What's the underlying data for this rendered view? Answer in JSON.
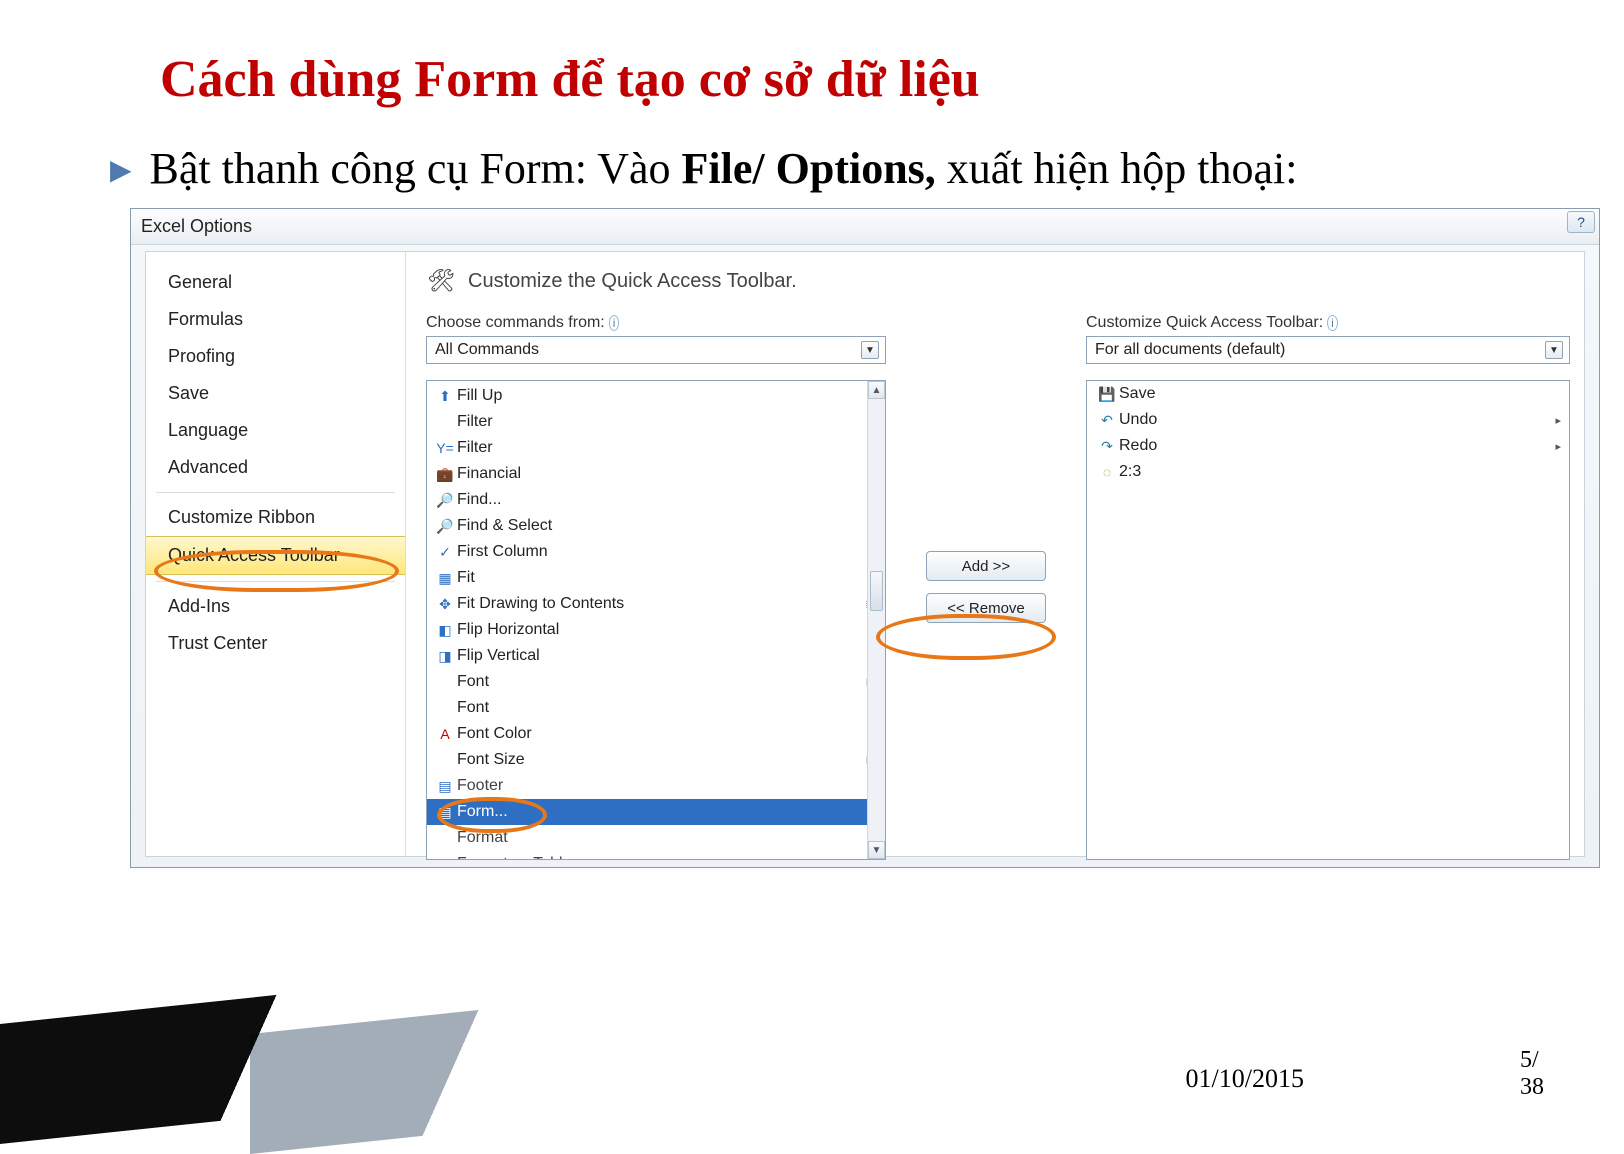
{
  "document": {
    "title": "Cách dùng Form để tạo cơ sở dữ liệu",
    "bullet_pre": "Bật thanh công cụ Form: Vào ",
    "bullet_bold": "File/ Options,",
    "bullet_post": " xuất hiện hộp thoại:",
    "footer_date": "01/10/2015",
    "footer_page_top": "5/",
    "footer_page_bot": "38"
  },
  "dialog": {
    "title": "Excel Options",
    "help": "?",
    "sidebar": {
      "items": [
        {
          "label": "General"
        },
        {
          "label": "Formulas"
        },
        {
          "label": "Proofing"
        },
        {
          "label": "Save"
        },
        {
          "label": "Language"
        },
        {
          "label": "Advanced"
        },
        {
          "label": "Customize Ribbon"
        },
        {
          "label": "Quick Access Toolbar",
          "selected": true
        },
        {
          "label": "Add-Ins"
        },
        {
          "label": "Trust Center"
        }
      ]
    },
    "main": {
      "heading": "Customize the Quick Access Toolbar.",
      "choose_label": "Choose commands from:",
      "choose_value": "All Commands",
      "customize_label": "Customize Quick Access Toolbar:",
      "customize_value": "For all documents (default)",
      "add_label": "Add >>",
      "remove_label": "<< Remove",
      "commands": [
        {
          "icon": "⬆",
          "label": "Fill Up"
        },
        {
          "icon": "",
          "label": "Filter",
          "sub": "▾"
        },
        {
          "icon": "Y=",
          "label": "Filter"
        },
        {
          "icon": "💼",
          "label": "Financial",
          "sub": "▸"
        },
        {
          "icon": "🔎",
          "label": "Find..."
        },
        {
          "icon": "🔎",
          "label": "Find & Select",
          "sub": "▸"
        },
        {
          "icon": "✓",
          "label": "First Column"
        },
        {
          "icon": "▦",
          "label": "Fit"
        },
        {
          "icon": "✥",
          "label": "Fit Drawing to Contents",
          "sub": "≣"
        },
        {
          "icon": "◧",
          "label": "Flip Horizontal"
        },
        {
          "icon": "◨",
          "label": "Flip Vertical"
        },
        {
          "icon": "",
          "label": "Font",
          "sub": "I▾"
        },
        {
          "icon": "",
          "label": "Font",
          "sub": "▾"
        },
        {
          "icon": "A",
          "label": "Font Color",
          "sub": "▸",
          "iconColor": "#c00000"
        },
        {
          "icon": "",
          "label": "Font Size",
          "sub": "I▾"
        },
        {
          "icon": "▤",
          "label": "Footer",
          "sub": "▸",
          "cut": true
        },
        {
          "icon": "▤",
          "label": "Form...",
          "selected": true
        },
        {
          "icon": "",
          "label": "Format",
          "sub": "▸",
          "cut": true
        },
        {
          "icon": "▦",
          "label": "Format as Table",
          "cut": true
        }
      ],
      "qat_items": [
        {
          "icon": "💾",
          "label": "Save",
          "iconColor": "#2a5ea0"
        },
        {
          "icon": "↶",
          "label": "Undo",
          "arrow": "▸",
          "iconColor": "#2a7ea0"
        },
        {
          "icon": "↷",
          "label": "Redo",
          "arrow": "▸",
          "iconColor": "#2a7ea0"
        },
        {
          "icon": "◌",
          "label": "2:3",
          "iconColor": "#6a9a3a"
        }
      ]
    }
  }
}
